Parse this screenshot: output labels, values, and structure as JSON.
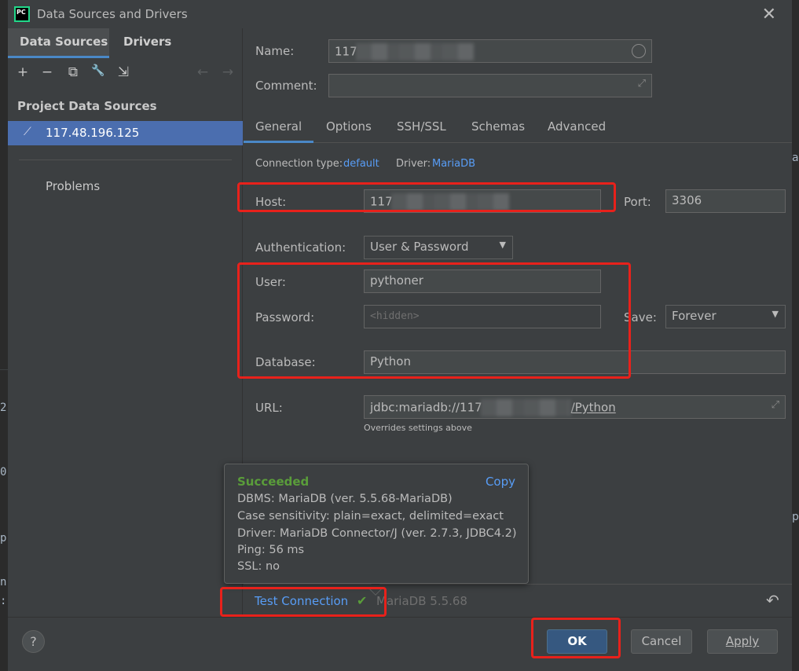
{
  "window": {
    "title": "Data Sources and Drivers",
    "app_icon": "PC",
    "close_icon": "close-icon"
  },
  "background": {
    "chars": [
      "2",
      "0",
      "p",
      "n",
      ":"
    ],
    "right_chars": [
      "a",
      "p"
    ]
  },
  "sidebar": {
    "tabs": [
      {
        "label": "Data Sources"
      },
      {
        "label": "Drivers"
      }
    ],
    "toolbar": {
      "add": "+",
      "remove": "−",
      "copy": "⧉",
      "wrench": "🔧",
      "import": "⇲",
      "back": "←",
      "forward": "→"
    },
    "section_title": "Project Data Sources",
    "items": [
      {
        "label": "117.48.196.125",
        "icon": "mariadb-icon"
      }
    ],
    "problems_label": "Problems"
  },
  "form": {
    "name_label": "Name:",
    "name_value": "117",
    "comment_label": "Comment:",
    "comment_value": "",
    "tabs": [
      {
        "label": "General"
      },
      {
        "label": "Options"
      },
      {
        "label": "SSH/SSL"
      },
      {
        "label": "Schemas"
      },
      {
        "label": "Advanced"
      }
    ],
    "connection_type_label": "Connection type:",
    "connection_type_value": "default",
    "driver_label": "Driver:",
    "driver_value": "MariaDB",
    "host_label": "Host:",
    "host_value": "117",
    "port_label": "Port:",
    "port_value": "3306",
    "auth_label": "Authentication:",
    "auth_value": "User & Password",
    "user_label": "User:",
    "user_value": "pythoner",
    "password_label": "Password:",
    "password_placeholder": "<hidden>",
    "save_label": "Save:",
    "save_value": "Forever",
    "database_label": "Database:",
    "database_value": "Python",
    "url_label": "URL:",
    "url_prefix": "jdbc:mariadb://117",
    "url_suffix": "/Python",
    "url_hint": "Overrides settings above"
  },
  "test": {
    "button_label": "Test Connection",
    "status_check": "✔",
    "status_text": "MariaDB 5.5.68",
    "revert_icon": "↶"
  },
  "popup": {
    "title": "Succeeded",
    "copy_label": "Copy",
    "lines": [
      "DBMS: MariaDB (ver. 5.5.68-MariaDB)",
      "Case sensitivity: plain=exact, delimited=exact",
      "Driver: MariaDB Connector/J (ver. 2.7.3, JDBC4.2)",
      "Ping: 56 ms",
      "SSL: no"
    ]
  },
  "footer": {
    "help_label": "?",
    "ok_label": "OK",
    "cancel_label": "Cancel",
    "apply_label": "Apply"
  },
  "colors": {
    "accent": "#4a88c7",
    "highlight_red": "#e8211b",
    "success_green": "#5a9d3a",
    "link": "#589df6"
  }
}
